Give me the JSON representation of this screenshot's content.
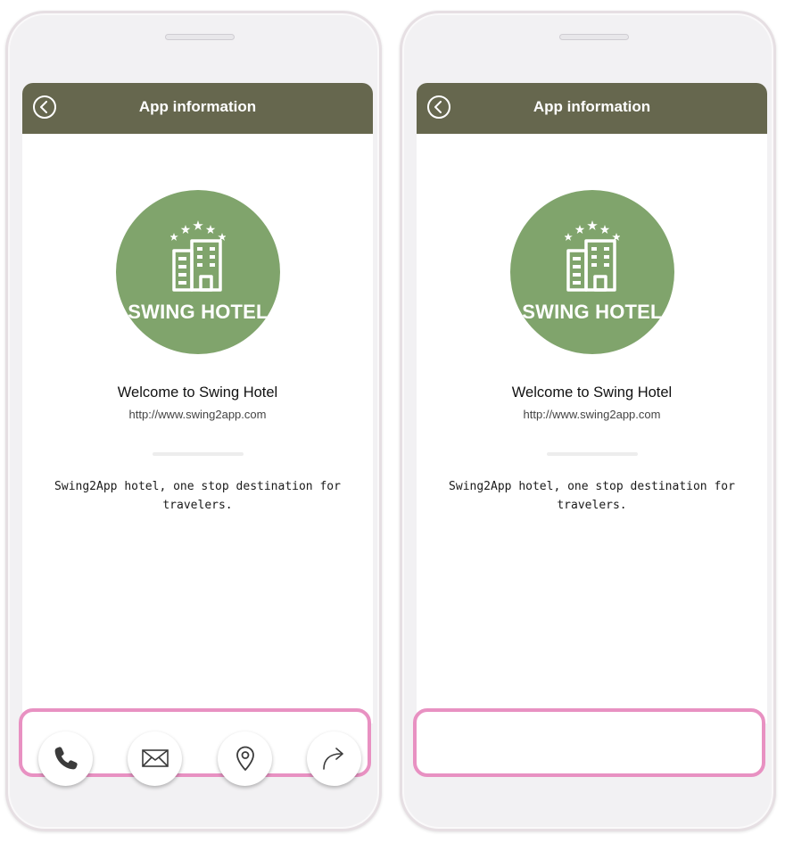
{
  "screens": [
    {
      "header": {
        "title": "App information"
      },
      "logo": {
        "text": "SWING HOTEL"
      },
      "welcome": "Welcome to Swing Hotel",
      "url": "http://www.swing2app.com",
      "description": "Swing2App hotel, one stop destination for travelers.",
      "actions": [
        {
          "icon": "phone-icon"
        },
        {
          "icon": "mail-icon"
        },
        {
          "icon": "location-pin-icon"
        },
        {
          "icon": "share-arrow-icon"
        }
      ]
    },
    {
      "header": {
        "title": "App information"
      },
      "logo": {
        "text": "SWING HOTEL"
      },
      "welcome": "Welcome to Swing Hotel",
      "url": "http://www.swing2app.com",
      "description": "Swing2App hotel, one stop destination for travelers.",
      "actions": []
    }
  ],
  "colors": {
    "header": "#66674e",
    "logo": "#80a46c",
    "highlight": "#e891c2"
  }
}
